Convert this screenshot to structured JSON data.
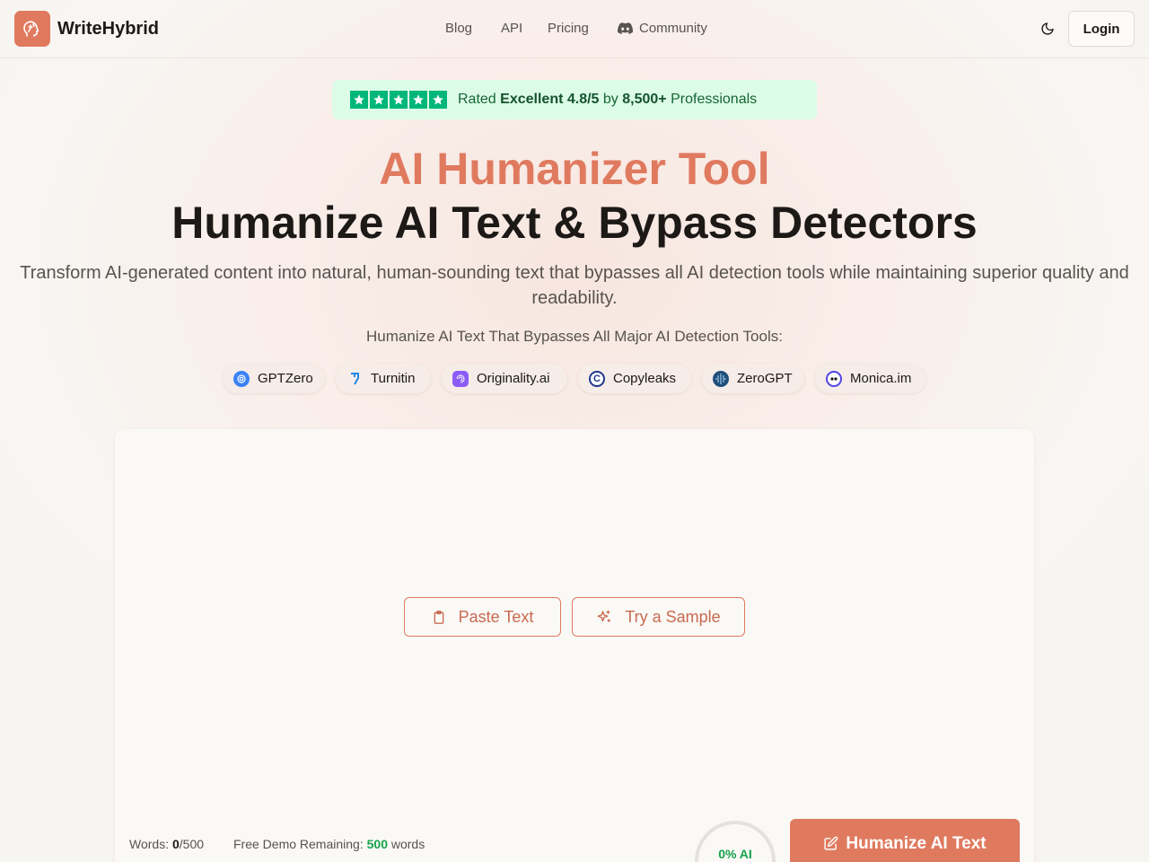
{
  "brand": {
    "name": "WriteHybrid",
    "icon": "brain-head-icon",
    "accent": "#e07a5f"
  },
  "nav": {
    "blog": "Blog",
    "api": "API",
    "pricing": "Pricing",
    "community": "Community",
    "community_icon": "discord-icon"
  },
  "header": {
    "theme_icon": "moon-icon",
    "login": "Login"
  },
  "rating": {
    "stars": 5,
    "prefix": "Rated",
    "grade": "Excellent 4.8/5",
    "by": "by",
    "count": "8,500+",
    "suffix": "Professionals"
  },
  "hero": {
    "title_accent": "AI Humanizer Tool",
    "title_main": "Humanize AI Text & Bypass Detectors",
    "subtitle": "Transform AI-generated content into natural, human-sounding text that bypasses all AI detection tools while maintaining superior quality and readability."
  },
  "detectors": {
    "heading": "Humanize AI Text That Bypasses All Major AI Detection Tools:",
    "items": [
      {
        "label": "GPTZero",
        "icon": "gptzero-icon",
        "color": "#3b82f6"
      },
      {
        "label": "Turnitin",
        "icon": "turnitin-icon",
        "color": "#1e88e5"
      },
      {
        "label": "Originality.ai",
        "icon": "originality-icon",
        "color": "#8b5cf6"
      },
      {
        "label": "Copyleaks",
        "icon": "copyleaks-icon",
        "color": "#1e3a8a"
      },
      {
        "label": "ZeroGPT",
        "icon": "zerogpt-icon",
        "color": "#1f4e79"
      },
      {
        "label": "Monica.im",
        "icon": "monica-icon",
        "color": "#4f46e5"
      }
    ]
  },
  "editor": {
    "paste_label": "Paste Text",
    "paste_icon": "clipboard-icon",
    "sample_label": "Try a Sample",
    "sample_icon": "sparkles-icon"
  },
  "footer": {
    "words_label": "Words:",
    "words_count": "0",
    "words_limit": "/500",
    "demo_label": "Free Demo Remaining:",
    "demo_value": "500",
    "demo_unit": "words",
    "ai_score": "0% AI",
    "humanize_label": "Humanize AI Text",
    "humanize_icon": "edit-icon"
  }
}
